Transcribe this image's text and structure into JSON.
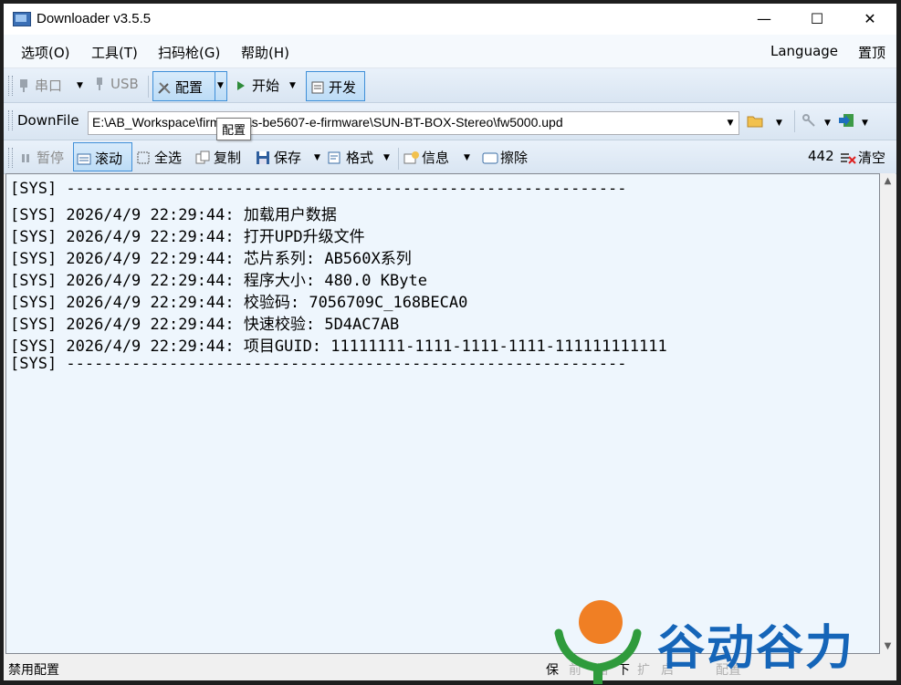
{
  "window": {
    "title": "Downloader v3.5.5",
    "minimize": "—",
    "maximize": "☐",
    "close": "✕"
  },
  "menu": [
    "选项(O)",
    "工具(T)",
    "扫码枪(G)",
    "帮助(H)"
  ],
  "menu_right": [
    "Language",
    "置顶"
  ],
  "toolbar1": {
    "serial": "串口",
    "usb": "USB",
    "config": "配置",
    "start": "开始",
    "develop": "开发"
  },
  "toolbar2": {
    "label": "DownFile",
    "path": "E:\\AB_Workspace\\firmware\\s-be5607-e-firmware\\SUN-BT-BOX-Stereo\\fw5000.upd",
    "tooltip": "配置"
  },
  "toolbar3": {
    "pause": "暂停",
    "scroll": "滚动",
    "select_all": "全选",
    "copy": "复制",
    "save": "保存",
    "format": "格式",
    "info": "信息",
    "erase": "擦除",
    "count": "442",
    "clear": "清空"
  },
  "log": [
    "[SYS] ------------------------------------------------------------",
    "[SYS] 2026/4/9 22:29:44: 加载用户数据",
    "[SYS] 2026/4/9 22:29:44: 打开UPD升级文件",
    "[SYS] 2026/4/9 22:29:44: 芯片系列: AB560X系列",
    "[SYS] 2026/4/9 22:29:44: 程序大小: 480.0 KByte",
    "[SYS] 2026/4/9 22:29:44: 校验码: 7056709C_168BECA0",
    "[SYS] 2026/4/9 22:29:44: 快速校验: 5D4AC7AB",
    "[SYS] 2026/4/9 22:29:44: 项目GUID: 11111111-1111-1111-1111-111111111111",
    "[SYS] ------------------------------------------------------------"
  ],
  "status": {
    "text": "禁用配置",
    "items": [
      "保",
      "前",
      "缩",
      "下",
      "扩",
      "启",
      "配置"
    ]
  },
  "watermark": {
    "text": "谷动谷力"
  },
  "colors": {
    "accent": "#3f8fd8",
    "log_bg": "#eef6fd",
    "watermark": "#1565b8"
  }
}
